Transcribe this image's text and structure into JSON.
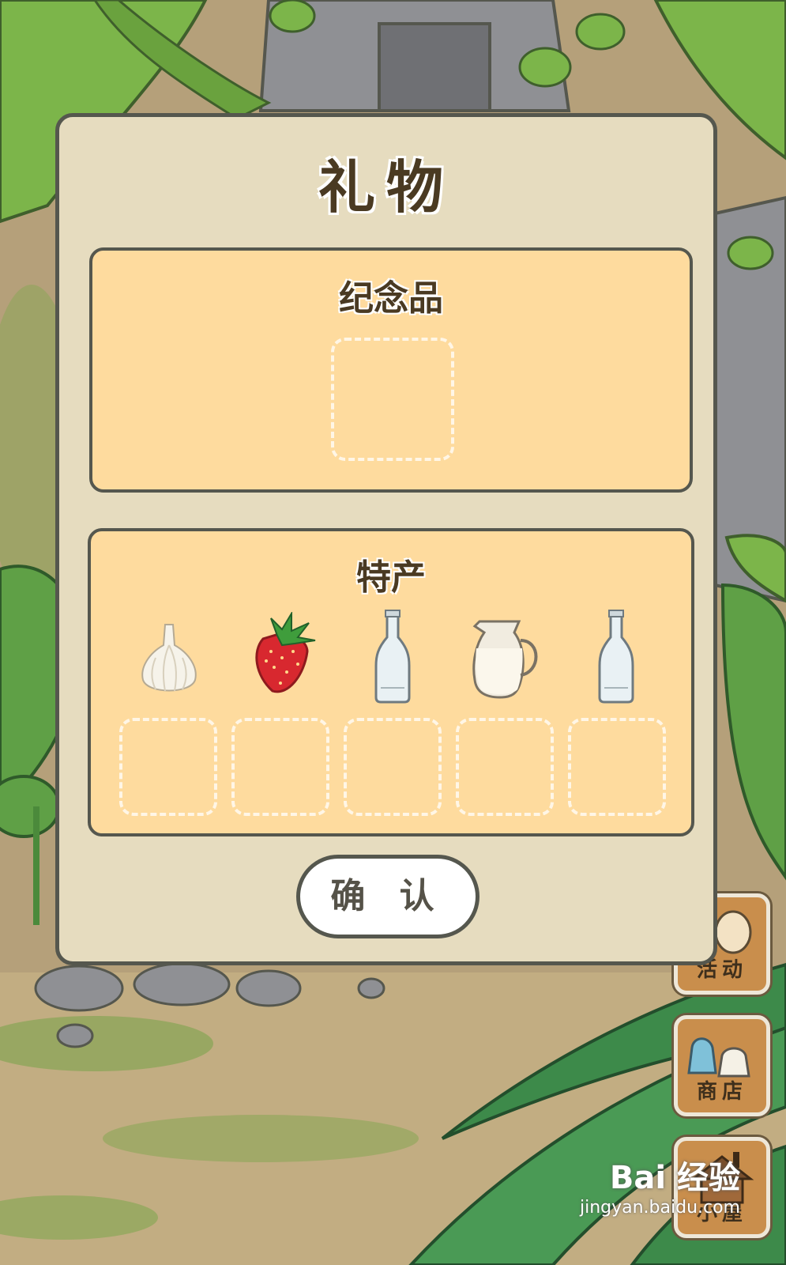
{
  "dialog": {
    "title": "礼物",
    "souvenir_section": {
      "label": "纪念品",
      "slots": 1
    },
    "specialty_section": {
      "label": "特产",
      "items": [
        {
          "name": "garlic-icon"
        },
        {
          "name": "strawberry-icon"
        },
        {
          "name": "glass-bottle-icon"
        },
        {
          "name": "milk-jug-icon"
        },
        {
          "name": "glass-bottle-icon"
        }
      ]
    },
    "confirm_label": "确 认"
  },
  "side_menu": {
    "activity_label": "活动",
    "shop_label": "商店",
    "home_label": "小屋"
  },
  "watermark": {
    "brand": "Bai 经验",
    "url": "jingyan.baidu.com"
  },
  "colors": {
    "dialog_bg": "#e6dcbf",
    "panel_bg": "#fedb9e",
    "border": "#55574e",
    "text": "#4a3a22"
  }
}
